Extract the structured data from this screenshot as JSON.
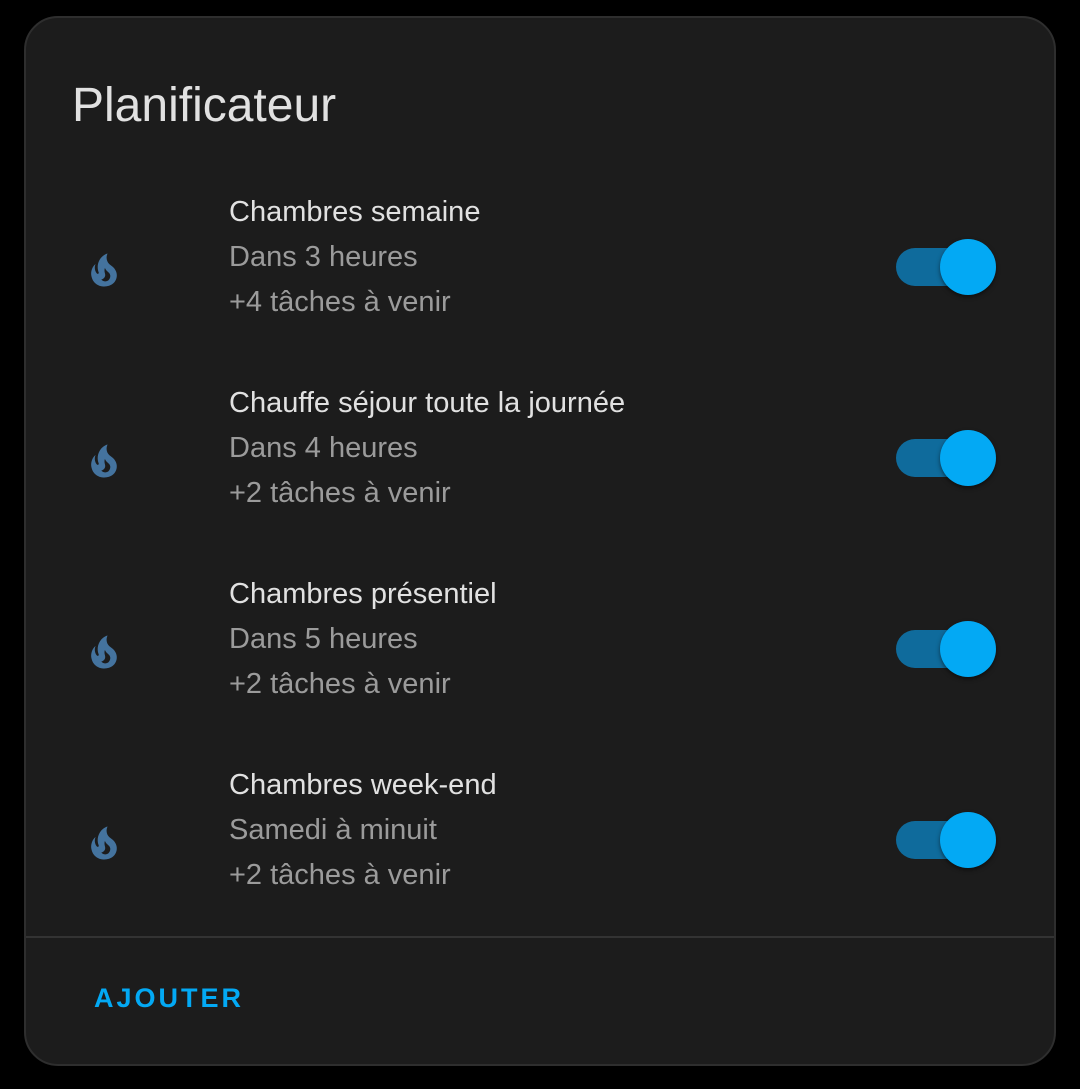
{
  "card": {
    "title": "Planificateur"
  },
  "schedules": [
    {
      "icon": "fire-icon",
      "name": "Chambres semaine",
      "next": "Dans 3 heures",
      "upcoming": "+4 tâches à venir",
      "enabled": true
    },
    {
      "icon": "fire-icon",
      "name": "Chauffe séjour toute la journée",
      "next": "Dans 4 heures",
      "upcoming": "+2 tâches à venir",
      "enabled": true
    },
    {
      "icon": "fire-icon",
      "name": "Chambres présentiel",
      "next": "Dans 5 heures",
      "upcoming": "+2 tâches à venir",
      "enabled": true
    },
    {
      "icon": "fire-icon",
      "name": "Chambres week-end",
      "next": "Samedi à minuit",
      "upcoming": "+2 tâches à venir",
      "enabled": true
    }
  ],
  "actions": {
    "add_label": "AJOUTER"
  },
  "colors": {
    "accent": "#03a9f4",
    "toggle_track": "#0f6b9c",
    "icon": "#44739e",
    "card_background": "#1c1c1c",
    "primary_text": "#e1e1e1",
    "secondary_text": "#9b9b9b"
  }
}
